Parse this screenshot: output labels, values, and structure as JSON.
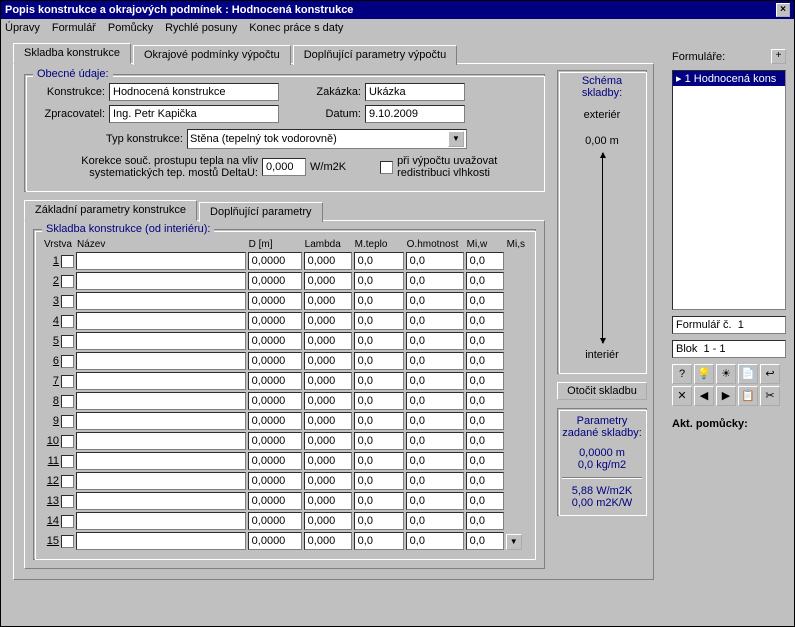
{
  "title": "Popis konstrukce a okrajových podmínek : Hodnocená konstrukce",
  "menu": [
    "Úpravy",
    "Formulář",
    "Pomůcky",
    "Rychlé posuny",
    "Konec práce s daty"
  ],
  "top_tabs": [
    "Skladba konstrukce",
    "Okrajové podmínky výpočtu",
    "Doplňující parametry výpočtu"
  ],
  "group_general": "Obecné údaje:",
  "lbl_konstrukce": "Konstrukce:",
  "val_konstrukce": "Hodnocená konstrukce",
  "lbl_zakazka": "Zakázka:",
  "val_zakazka": "Ukázka",
  "lbl_zpracovatel": "Zpracovatel:",
  "val_zpracovatel": "Ing. Petr Kapička",
  "lbl_datum": "Datum:",
  "val_datum": "9.10.2009",
  "lbl_typ": "Typ konstrukce:",
  "val_typ": "Stěna (tepelný tok vodorovně)",
  "lbl_korekce": "Korekce souč. prostupu tepla na vliv systematických tep. mostů DeltaU:",
  "val_korekce": "0,000",
  "unit_korekce": "W/m2K",
  "chk_redistrib": "při výpočtu uvažovat redistribuci vlhkosti",
  "inner_tabs": [
    "Základní parametry konstrukce",
    "Doplňující parametry"
  ],
  "group_skladba": "Skladba konstrukce (od interiéru):",
  "cols": [
    "Vrstva",
    "Název",
    "D [m]",
    "Lambda",
    "M.teplo",
    "O.hmotnost",
    "Mi,w",
    "Mi,s"
  ],
  "rows": [
    {
      "n": "1",
      "nazev": "",
      "d": "0,0000",
      "l": "0,000",
      "m": "0,0",
      "o": "0,0",
      "miw": "0,0",
      "mis": ""
    },
    {
      "n": "2",
      "nazev": "",
      "d": "0,0000",
      "l": "0,000",
      "m": "0,0",
      "o": "0,0",
      "miw": "0,0",
      "mis": ""
    },
    {
      "n": "3",
      "nazev": "",
      "d": "0,0000",
      "l": "0,000",
      "m": "0,0",
      "o": "0,0",
      "miw": "0,0",
      "mis": ""
    },
    {
      "n": "4",
      "nazev": "",
      "d": "0,0000",
      "l": "0,000",
      "m": "0,0",
      "o": "0,0",
      "miw": "0,0",
      "mis": ""
    },
    {
      "n": "5",
      "nazev": "",
      "d": "0,0000",
      "l": "0,000",
      "m": "0,0",
      "o": "0,0",
      "miw": "0,0",
      "mis": ""
    },
    {
      "n": "6",
      "nazev": "",
      "d": "0,0000",
      "l": "0,000",
      "m": "0,0",
      "o": "0,0",
      "miw": "0,0",
      "mis": ""
    },
    {
      "n": "7",
      "nazev": "",
      "d": "0,0000",
      "l": "0,000",
      "m": "0,0",
      "o": "0,0",
      "miw": "0,0",
      "mis": ""
    },
    {
      "n": "8",
      "nazev": "",
      "d": "0,0000",
      "l": "0,000",
      "m": "0,0",
      "o": "0,0",
      "miw": "0,0",
      "mis": ""
    },
    {
      "n": "9",
      "nazev": "",
      "d": "0,0000",
      "l": "0,000",
      "m": "0,0",
      "o": "0,0",
      "miw": "0,0",
      "mis": ""
    },
    {
      "n": "10",
      "nazev": "",
      "d": "0,0000",
      "l": "0,000",
      "m": "0,0",
      "o": "0,0",
      "miw": "0,0",
      "mis": ""
    },
    {
      "n": "11",
      "nazev": "",
      "d": "0,0000",
      "l": "0,000",
      "m": "0,0",
      "o": "0,0",
      "miw": "0,0",
      "mis": ""
    },
    {
      "n": "12",
      "nazev": "",
      "d": "0,0000",
      "l": "0,000",
      "m": "0,0",
      "o": "0,0",
      "miw": "0,0",
      "mis": ""
    },
    {
      "n": "13",
      "nazev": "",
      "d": "0,0000",
      "l": "0,000",
      "m": "0,0",
      "o": "0,0",
      "miw": "0,0",
      "mis": ""
    },
    {
      "n": "14",
      "nazev": "",
      "d": "0,0000",
      "l": "0,000",
      "m": "0,0",
      "o": "0,0",
      "miw": "0,0",
      "mis": ""
    },
    {
      "n": "15",
      "nazev": "",
      "d": "0,0000",
      "l": "0,000",
      "m": "0,0",
      "o": "0,0",
      "miw": "0,0",
      "mis": ""
    }
  ],
  "schema_title": "Schéma skladby:",
  "schema_top": "exteriér",
  "schema_thickness": "0,00 m",
  "schema_bottom": "interiér",
  "btn_otocit": "Otočit skladbu",
  "params_title": "Parametry zadané skladby:",
  "params_l1": "0,0000 m",
  "params_l2": "0,0 kg/m2",
  "params_l3": "5,88 W/m2K",
  "params_l4": "0,00 m2K/W",
  "formulare_label": "Formuláře:",
  "formulare_item": "1 Hodnocená kons",
  "formular_c": "Formulář č.  1",
  "blok": "Blok  1 - 1",
  "akt_pomucky": "Akt. pomůcky:",
  "tool_icons": [
    "?",
    "💡",
    "☀",
    "📄",
    "↩",
    "✕",
    "◀",
    "▶",
    "📋",
    "✂"
  ]
}
